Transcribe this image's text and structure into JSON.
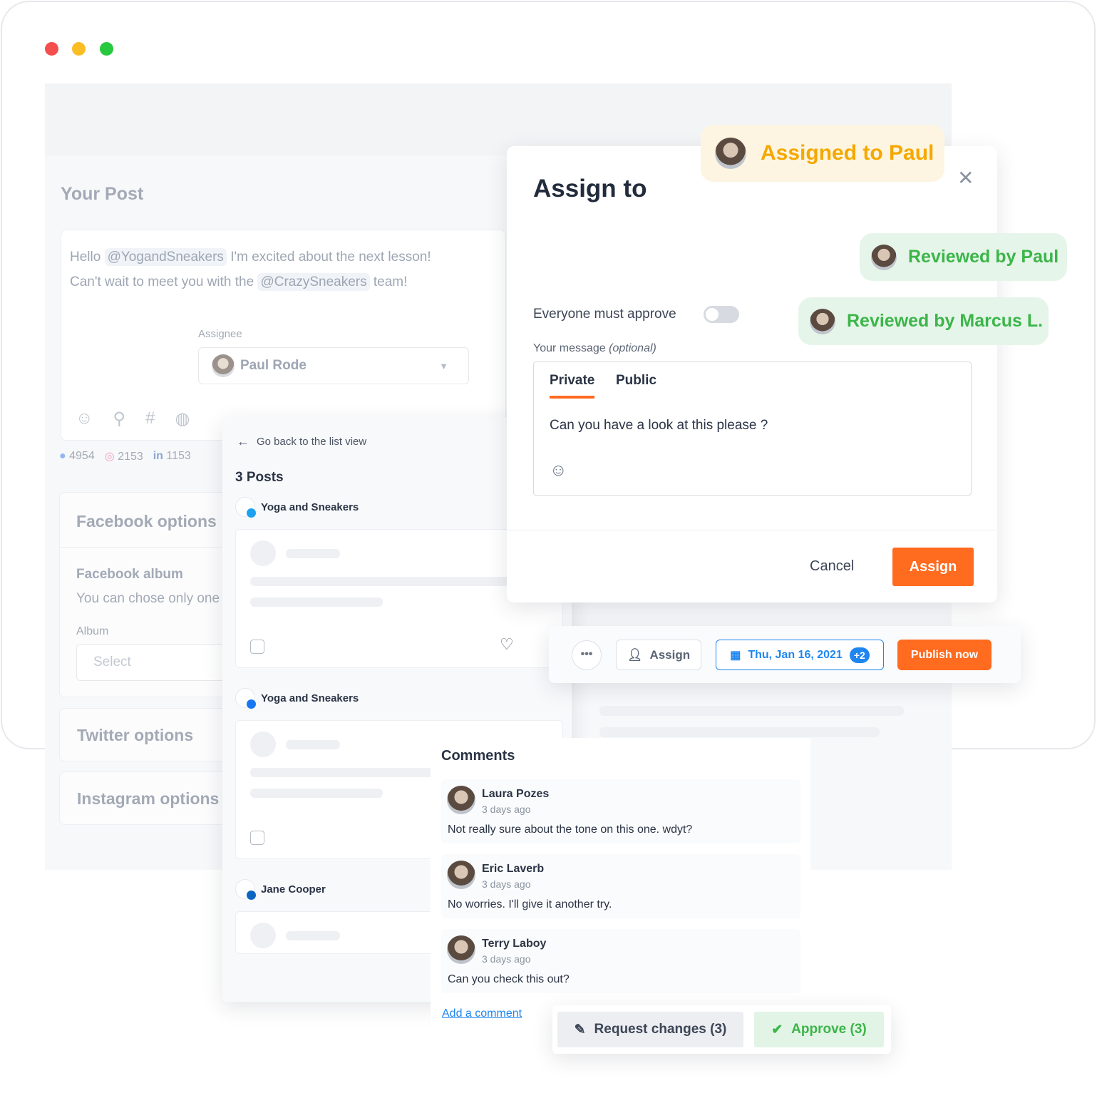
{
  "window": {
    "controls": [
      "close",
      "minimize",
      "maximize"
    ],
    "colors": {
      "close": "#f44e4e",
      "minimize": "#fbbd24",
      "maximize": "#27c93f"
    }
  },
  "post": {
    "title": "Your Post",
    "text_line1_a": "Hello",
    "mention1": "@YogandSneakers",
    "text_line1_b": "I'm excited about the next lesson!",
    "text_line2_a": "Can't wait to meet you with the",
    "mention2": "@CrazySneakers",
    "text_line2_b": "team!",
    "assignee_label": "Assignee",
    "assignee_value": "Paul Rode",
    "stats": [
      {
        "icon": "facebook-icon",
        "value": "4954"
      },
      {
        "icon": "instagram-icon",
        "value": "2153"
      },
      {
        "icon": "linkedin-icon",
        "value": "1153"
      }
    ]
  },
  "options": {
    "facebook_title": "Facebook options",
    "album_title": "Facebook album",
    "album_desc": "You can chose only one",
    "album_label": "Album",
    "album_placeholder": "Select",
    "twitter_title": "Twitter options",
    "instagram_title": "Instagram options"
  },
  "posts_panel": {
    "back": "Go back to the list view",
    "count": "3 Posts",
    "items": [
      {
        "account": "Yoga and Sneakers",
        "network": "twitter"
      },
      {
        "account": "Yoga and Sneakers",
        "network": "facebook"
      },
      {
        "account": "Jane Cooper",
        "network": "linkedin"
      }
    ]
  },
  "modal": {
    "title": "Assign to",
    "approve_label": "Everyone must approve",
    "approve_on": false,
    "message_label": "Your message",
    "message_optional": "(optional)",
    "tabs": [
      "Private",
      "Public"
    ],
    "active_tab": "Private",
    "message": "Can you have a look at this please ?",
    "cancel": "Cancel",
    "assign": "Assign"
  },
  "badges": {
    "assigned": "Assigned to Paul",
    "reviewed1": "Reviewed by Paul",
    "reviewed2": "Reviewed by Marcus L."
  },
  "toolbar": {
    "assign": "Assign",
    "date": "Thu, Jan 16, 2021",
    "extra": "+2",
    "publish": "Publish now"
  },
  "comments": {
    "title": "Comments",
    "items": [
      {
        "name": "Laura Pozes",
        "time": "3 days ago",
        "text": "Not really sure about the tone on this one. wdyt?"
      },
      {
        "name": "Eric Laverb",
        "time": "3 days ago",
        "text": "No worries. I'll give it another try."
      },
      {
        "name": "Terry Laboy",
        "time": "3 days ago",
        "text": "Can you check this out?"
      }
    ],
    "add": "Add a comment"
  },
  "review": {
    "request": "Request changes (3)",
    "approve": "Approve (3)"
  },
  "colors": {
    "accent": "#ff6b1f",
    "blue": "#1f86f0",
    "green": "#3cb54a",
    "yellow": "#f5a800"
  }
}
